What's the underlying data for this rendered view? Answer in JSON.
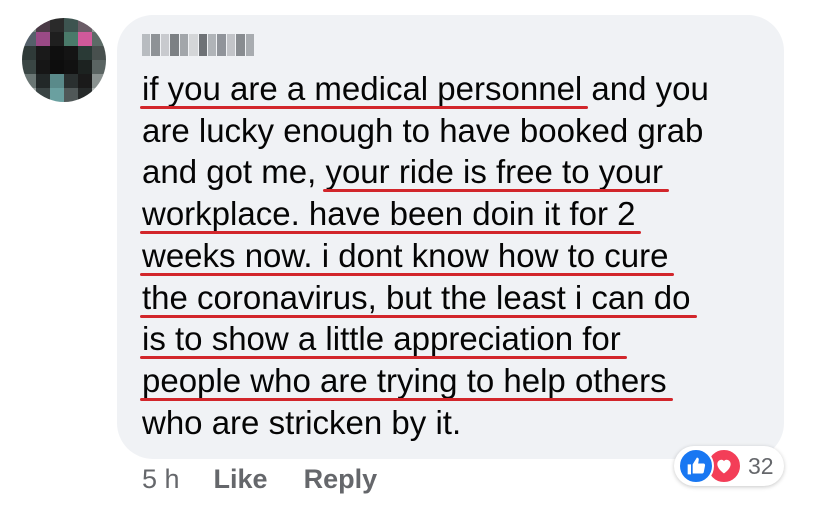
{
  "comment": {
    "author_name": "",
    "lines": [
      {
        "segments": [
          {
            "t": "if you are a medical personnel",
            "u": true
          },
          {
            "t": " and you",
            "u": false
          }
        ]
      },
      {
        "segments": [
          {
            "t": "are lucky enough to have booked grab",
            "u": false
          }
        ]
      },
      {
        "segments": [
          {
            "t": "and got me, ",
            "u": false
          },
          {
            "t": "your ride is free to your",
            "u": true
          }
        ]
      },
      {
        "segments": [
          {
            "t": "workplace. have been doin it for 2",
            "u": true
          }
        ]
      },
      {
        "segments": [
          {
            "t": "weeks now. i dont know how to cure",
            "u": true
          }
        ]
      },
      {
        "segments": [
          {
            "t": "the coronavirus, but the least i can do",
            "u": true
          }
        ]
      },
      {
        "segments": [
          {
            "t": "is to show a little appreciation for",
            "u": true
          }
        ]
      },
      {
        "segments": [
          {
            "t": "people who are trying to help others",
            "u": true
          }
        ]
      },
      {
        "segments": [
          {
            "t": "who are stricken by it.",
            "u": false
          }
        ]
      }
    ]
  },
  "meta": {
    "time": "5 h",
    "like_label": "Like",
    "reply_label": "Reply"
  },
  "reactions": {
    "icons": [
      "like-icon",
      "love-icon"
    ],
    "count": "32"
  },
  "colors": {
    "bubble": "#f0f2f5",
    "underline": "#d2262b",
    "like": "#1877f2",
    "love": "#f33e58",
    "meta_text": "#65676b"
  },
  "avatar": {
    "pixelated": true,
    "cells": [
      "#7a8a82",
      "#4a3a46",
      "#2a2a2a",
      "#3d5450",
      "#6a5c66",
      "#8f9a96",
      "#55606a",
      "#9a4a86",
      "#1f1f1f",
      "#4a7a6a",
      "#d0599a",
      "#5c6b66",
      "#2f3a38",
      "#1a1a1a",
      "#0f0f0f",
      "#141414",
      "#2a3a36",
      "#48504e",
      "#3a4644",
      "#161616",
      "#0d0d0d",
      "#111111",
      "#1c2220",
      "#5a6462",
      "#6a7674",
      "#222828",
      "#5a8a8a",
      "#2a3030",
      "#1a1a1a",
      "#8a9290",
      "#9aa2a0",
      "#3a4444",
      "#6aa0a0",
      "#505858",
      "#262a2a",
      "#b0b6b4"
    ]
  },
  "name_blur_cells": [
    "#b8bcc0",
    "#8e9296",
    "#c8cace",
    "#7c8084",
    "#a2a6aa",
    "#d4d6d8",
    "#6e7276",
    "#b0b4b8",
    "#90949a",
    "#c2c4c8",
    "#888c90",
    "#a8acb0"
  ]
}
